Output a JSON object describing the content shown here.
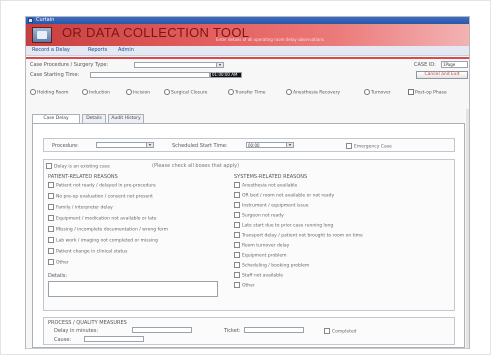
{
  "window": {
    "title": "Curtain"
  },
  "banner": {
    "title": "OR DATA COLLECTION TOOL",
    "subtitle": "Enter details of all operating room delay observations"
  },
  "menu": {
    "items": [
      "Record a Delay",
      "Reports",
      "Admin"
    ]
  },
  "header": {
    "case_type_label": "Case Procedure / Surgery Type:",
    "case_type_value": "",
    "case_start_label": "Case Starting Time:",
    "case_start_value": "",
    "case_start_time": "01:00:00 AM",
    "case_id_label": "CASE ID:",
    "case_id_value": "1Page",
    "cancel_button": "Cancel and Exit"
  },
  "delay_types": [
    "Holding Room",
    "Induction",
    "Incision",
    "Surgical Closure",
    "Transfer Time",
    "Anesthesia Recovery",
    "Turnover",
    "Post-op Phase"
  ],
  "tabs": [
    "Case Delay Information",
    "Details",
    "Audit History"
  ],
  "delay_info": {
    "procedure_label": "Procedure:",
    "procedure_value": "",
    "scheduled_start_label": "Scheduled Start Time:",
    "scheduled_start_value": "00:00",
    "emergency_label": "Emergency Case"
  },
  "reasons": {
    "header_checkbox": "Delay is an existing case",
    "header_hint": "(Please check all boxes that apply)",
    "left_title": "PATIENT-RELATED REASONS",
    "left_items": [
      "Patient not ready / delayed in pre-procedure",
      "No pre-op evaluation / consent not present",
      "Family / interpreter delay",
      "Equipment / medication not available or late",
      "Missing / incomplete documentation / wrong form",
      "Lab work / imaging not completed or missing",
      "Patient change in clinical status",
      "Other"
    ],
    "other_label": "Details:",
    "right_title": "SYSTEMS-RELATED REASONS",
    "right_items": [
      "Anesthesia not available",
      "OR bed / room not available or not ready",
      "Instrument / equipment issue",
      "Surgeon not ready",
      "Late start due to prior case running long",
      "Transport delay / patient not brought to room on time",
      "Room turnover delay",
      "Equipment problem",
      "Scheduling / booking problem",
      "Staff not available",
      "Other"
    ]
  },
  "quality": {
    "title": "PROCESS / QUALITY MEASURES",
    "delay_label": "Delay in minutes:",
    "delay_value": "",
    "ticket_label": "Ticket:",
    "ticket_value": "",
    "completed_label": "Completed",
    "cause_label": "Cause:",
    "cause_value": ""
  }
}
